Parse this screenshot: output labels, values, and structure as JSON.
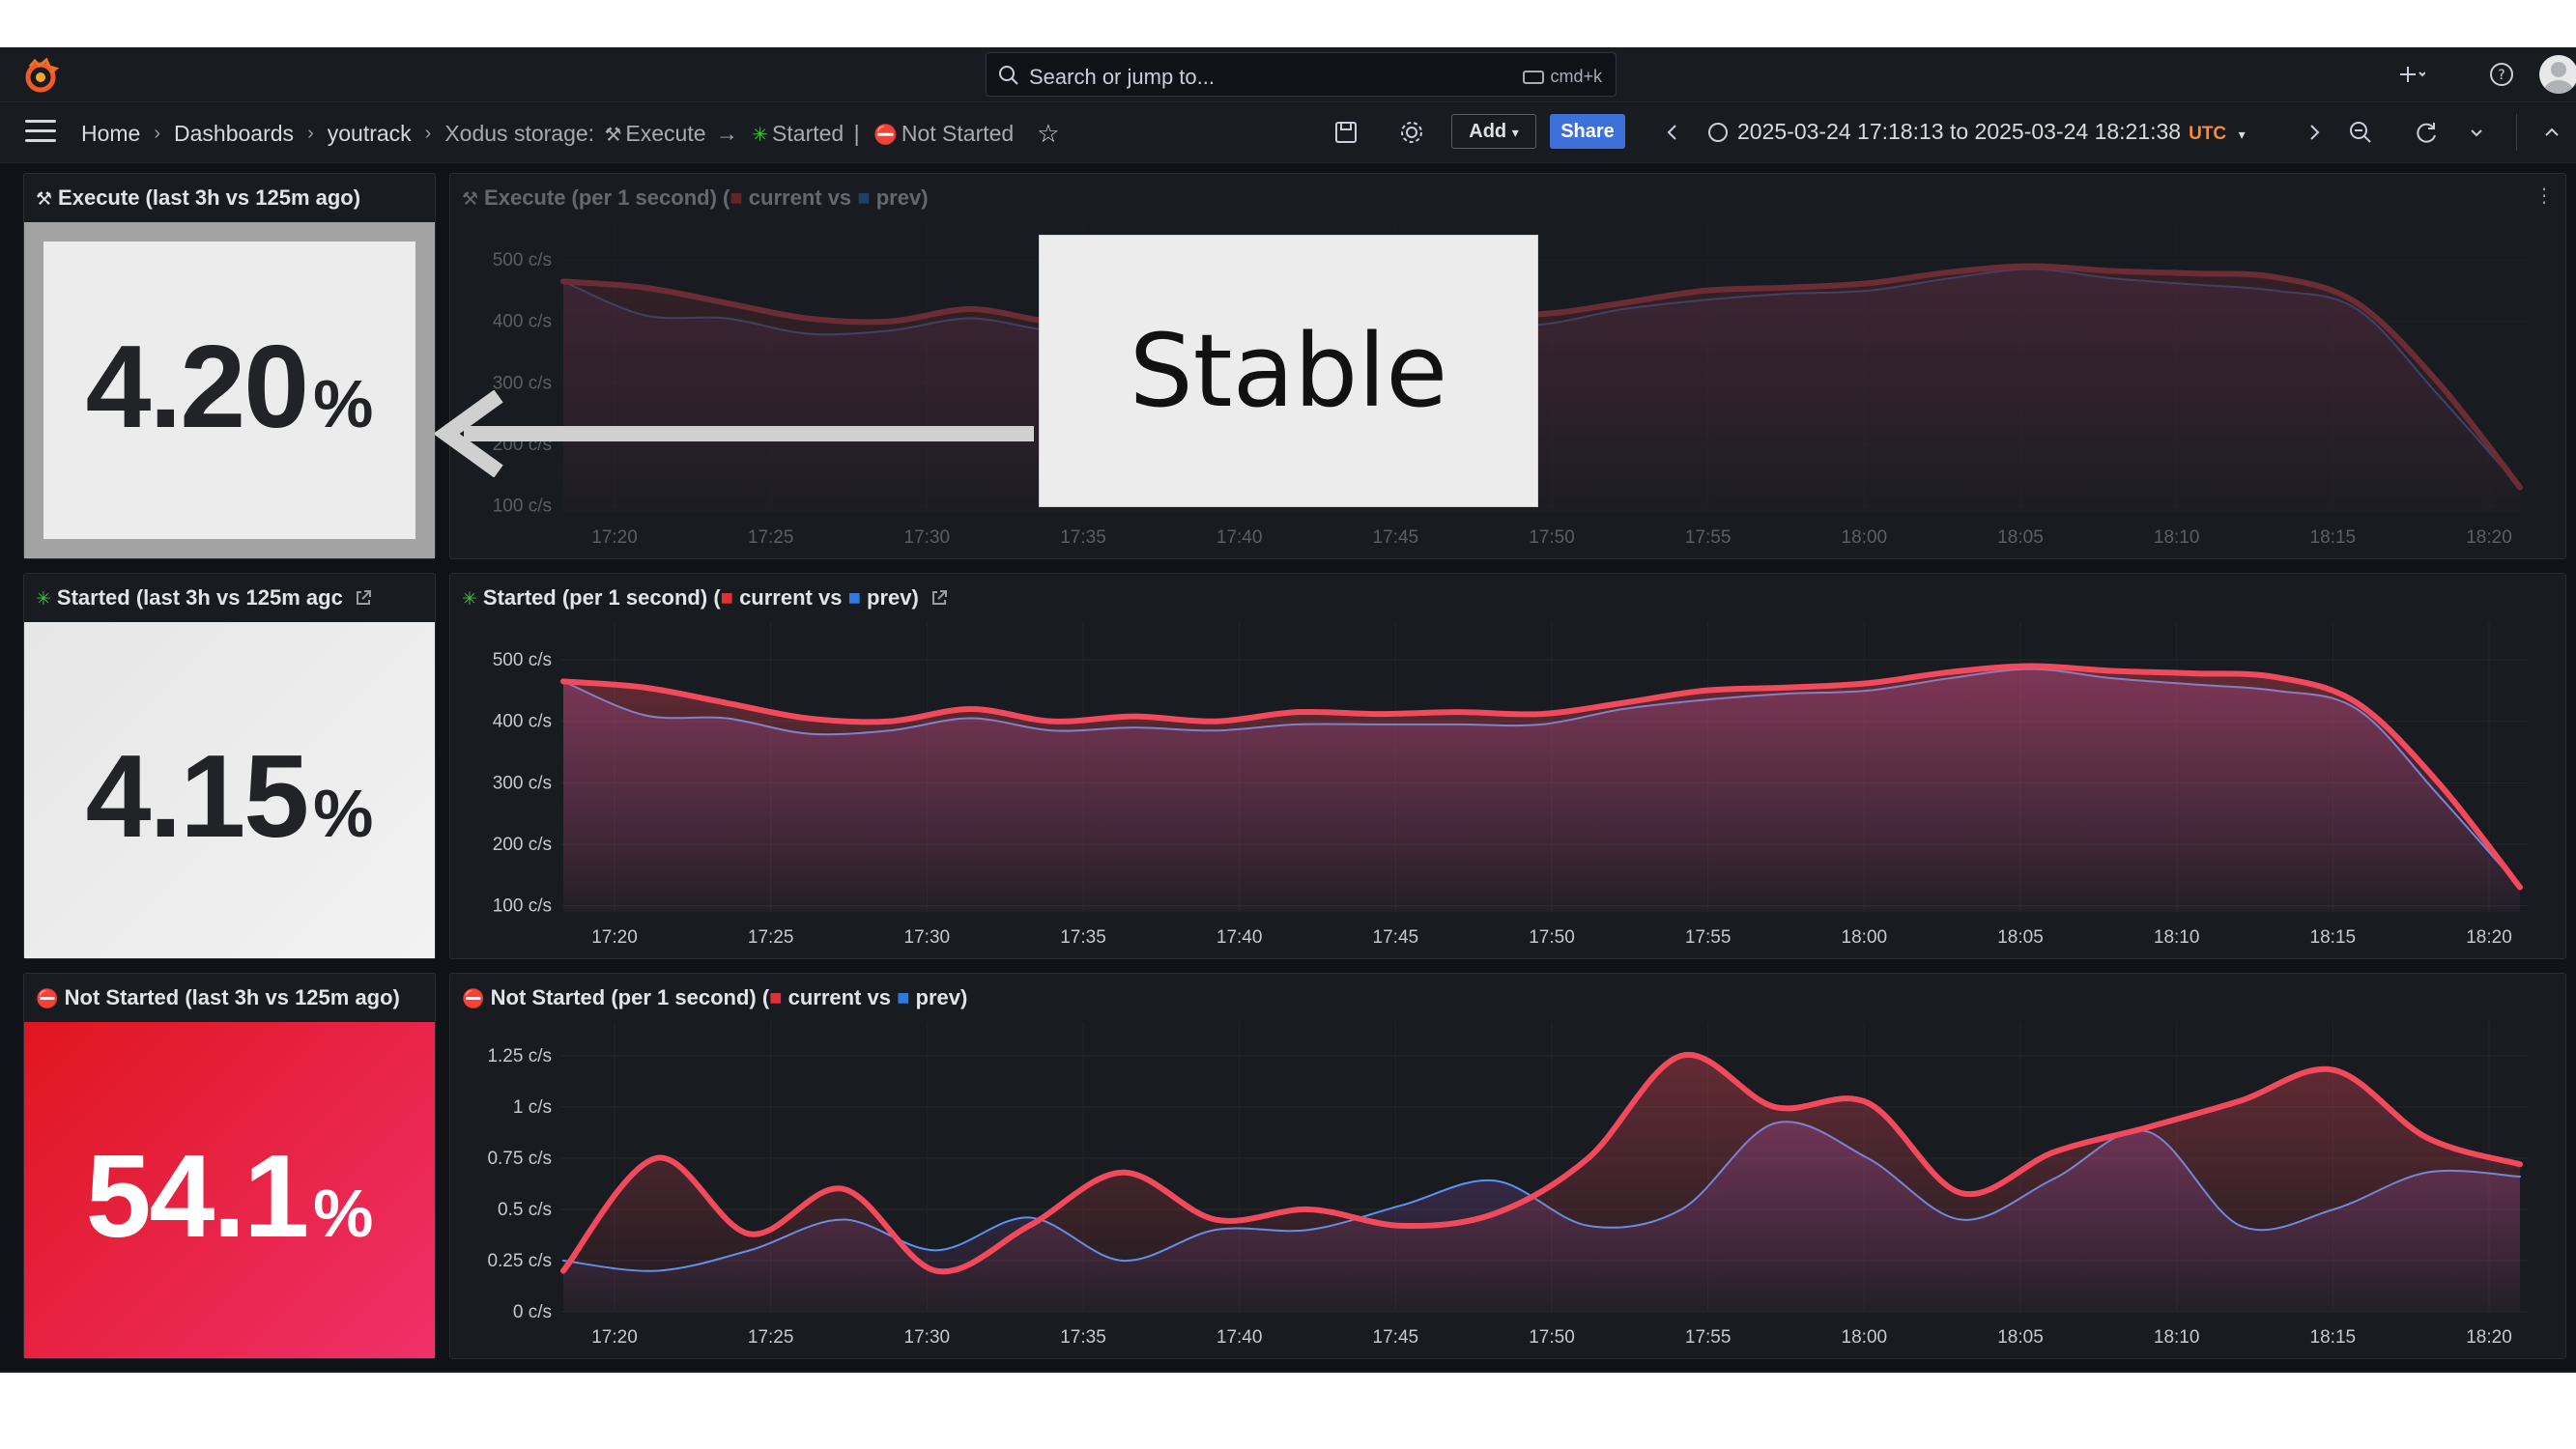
{
  "topbar": {
    "search_placeholder": "Search or jump to...",
    "search_shortcut": "cmd+k"
  },
  "nav": {
    "breadcrumbs": [
      "Home",
      "Dashboards",
      "youtrack"
    ],
    "current_prefix": "Xodus storage:",
    "current_items": [
      "Execute",
      "Started",
      "Not Started"
    ],
    "current_arrow": "→",
    "current_divider": "|",
    "add_label": "Add",
    "share_label": "Share",
    "time_range": "2025-03-24 17:18:13 to 2025-03-24 18:21:38",
    "timezone": "UTC"
  },
  "panels": {
    "execute_stat": {
      "title": "Execute (last 3h vs 125m ago)",
      "value": "4.20",
      "unit": "%"
    },
    "execute_chart": {
      "title_prefix": "Execute (per 1 second) (",
      "title_mid": "current vs",
      "title_suffix": "prev)"
    },
    "started_stat": {
      "title": "Started (last 3h vs 125m agc",
      "value": "4.15",
      "unit": "%"
    },
    "started_chart": {
      "title_prefix": "Started (per 1 second) (",
      "title_mid": "current vs",
      "title_suffix": "prev)"
    },
    "notstarted_stat": {
      "title": "Not Started (last 3h vs 125m ago)",
      "value": "54.1",
      "unit": "%"
    },
    "notstarted_chart": {
      "title_prefix": "Not Started (per 1 second) (",
      "title_mid": "current vs",
      "title_suffix": "prev)"
    }
  },
  "annotation": {
    "label": "Stable"
  },
  "colors": {
    "current": "#f2495c",
    "prev": "#5794f2",
    "stat_bg": "#e8e8e8",
    "stat_red_start": "#e0161f",
    "stat_red_end": "#f0306a",
    "orange_tz": "#ff8833"
  },
  "chart_data": [
    {
      "type": "area",
      "name": "execute",
      "x": [
        "17:20",
        "17:25",
        "17:30",
        "17:35",
        "17:40",
        "17:45",
        "17:50",
        "17:55",
        "18:00",
        "18:05",
        "18:10",
        "18:15",
        "18:20"
      ],
      "y_ticks": [
        "100 c/s",
        "200 c/s",
        "300 c/s",
        "400 c/s",
        "500 c/s"
      ],
      "ylim": [
        90,
        530
      ],
      "series": [
        {
          "name": "current",
          "values": [
            465,
            455,
            430,
            405,
            400,
            420,
            400,
            408,
            400,
            415,
            412,
            415,
            412,
            430,
            450,
            455,
            462,
            480,
            490,
            482,
            478,
            472,
            430,
            300,
            130
          ]
        },
        {
          "name": "prev",
          "values": [
            465,
            410,
            405,
            380,
            385,
            405,
            385,
            390,
            385,
            395,
            395,
            395,
            395,
            420,
            435,
            445,
            450,
            470,
            485,
            470,
            460,
            450,
            420,
            280,
            130
          ]
        }
      ]
    },
    {
      "type": "area",
      "name": "started",
      "x": [
        "17:20",
        "17:25",
        "17:30",
        "17:35",
        "17:40",
        "17:45",
        "17:50",
        "17:55",
        "18:00",
        "18:05",
        "18:10",
        "18:15",
        "18:20"
      ],
      "y_ticks": [
        "100 c/s",
        "200 c/s",
        "300 c/s",
        "400 c/s",
        "500 c/s"
      ],
      "ylim": [
        90,
        530
      ],
      "series": [
        {
          "name": "current",
          "values": [
            465,
            455,
            430,
            405,
            400,
            420,
            400,
            408,
            400,
            415,
            412,
            415,
            412,
            430,
            450,
            455,
            462,
            480,
            490,
            482,
            478,
            472,
            430,
            300,
            130
          ]
        },
        {
          "name": "prev",
          "values": [
            465,
            410,
            405,
            380,
            385,
            405,
            385,
            390,
            385,
            395,
            395,
            395,
            395,
            420,
            435,
            445,
            450,
            470,
            485,
            470,
            460,
            450,
            420,
            280,
            130
          ]
        }
      ]
    },
    {
      "type": "area",
      "name": "not_started",
      "x": [
        "17:20",
        "17:25",
        "17:30",
        "17:35",
        "17:40",
        "17:45",
        "17:50",
        "17:55",
        "18:00",
        "18:05",
        "18:10",
        "18:15",
        "18:20"
      ],
      "y_ticks": [
        "0 c/s",
        "0.25 c/s",
        "0.5 c/s",
        "0.75 c/s",
        "1 c/s",
        "1.25 c/s"
      ],
      "ylim": [
        0,
        1.32
      ],
      "series": [
        {
          "name": "current",
          "values": [
            0.2,
            0.75,
            0.38,
            0.6,
            0.2,
            0.42,
            0.68,
            0.45,
            0.5,
            0.42,
            0.48,
            0.75,
            1.25,
            1.0,
            1.02,
            0.58,
            0.78,
            0.9,
            1.03,
            1.18,
            0.85,
            0.72
          ]
        },
        {
          "name": "prev",
          "values": [
            0.25,
            0.2,
            0.3,
            0.45,
            0.3,
            0.46,
            0.25,
            0.4,
            0.4,
            0.52,
            0.64,
            0.42,
            0.5,
            0.92,
            0.75,
            0.45,
            0.65,
            0.88,
            0.42,
            0.5,
            0.68,
            0.66
          ]
        }
      ]
    }
  ]
}
